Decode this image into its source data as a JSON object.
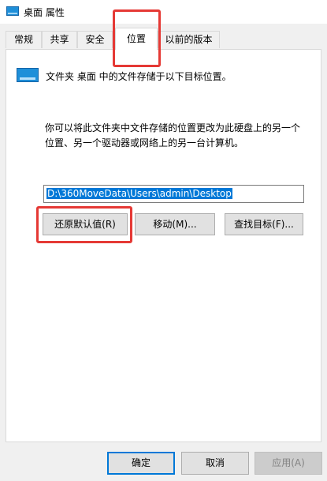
{
  "window": {
    "title": "桌面 属性"
  },
  "tabs": [
    {
      "label": "常规"
    },
    {
      "label": "共享"
    },
    {
      "label": "安全"
    },
    {
      "label": "位置"
    },
    {
      "label": "以前的版本"
    }
  ],
  "active_tab": "位置",
  "location": {
    "header_text": "文件夹 桌面 中的文件存储于以下目标位置。",
    "description_line1": "你可以将此文件夹中文件存储的位置更改为此硬盘上的另一个",
    "description_line2": "位置、另一个驱动器或网络上的另一台计算机。",
    "path_value": "D:\\360MoveData\\Users\\admin\\Desktop",
    "restore_default_label": "还原默认值(R)",
    "move_label": "移动(M)...",
    "find_target_label": "查找目标(F)..."
  },
  "footer": {
    "ok_label": "确定",
    "cancel_label": "取消",
    "apply_label": "应用(A)"
  },
  "colors": {
    "highlight_box": "#e53935",
    "selection": "#0078d7",
    "folder_icon": "#1e8fd9"
  },
  "icons": {
    "title_icon": "desktop-folder-icon",
    "location_icon": "desktop-folder-icon"
  }
}
